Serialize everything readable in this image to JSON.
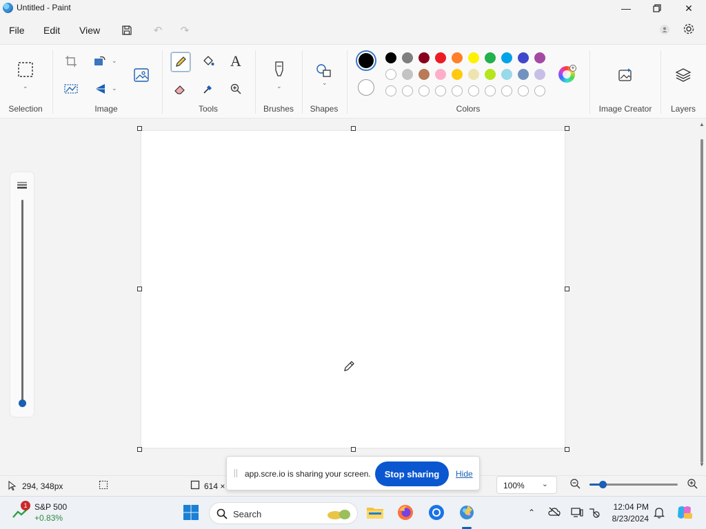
{
  "window": {
    "title": "Untitled - Paint"
  },
  "menu": {
    "file": "File",
    "edit": "Edit",
    "view": "View"
  },
  "ribbon": {
    "groups": {
      "selection": "Selection",
      "image": "Image",
      "tools": "Tools",
      "brushes": "Brushes",
      "shapes": "Shapes",
      "colors": "Colors",
      "image_creator": "Image Creator",
      "layers": "Layers"
    },
    "palette_row1": [
      "#000000",
      "#7f7f7f",
      "#88001b",
      "#ec1c24",
      "#ff7f27",
      "#fff200",
      "#22b14c",
      "#00a2e8",
      "#3f48cc",
      "#a349a4"
    ],
    "palette_row2": [
      "#ffffff",
      "#c3c3c3",
      "#b97a57",
      "#ffaec9",
      "#ffc90e",
      "#efe4b0",
      "#b5e61d",
      "#99d9ea",
      "#7092be",
      "#c8bfe7"
    ],
    "primary_color": "#000000",
    "secondary_color": "#ffffff"
  },
  "status": {
    "cursor_pos": "294, 348px",
    "canvas_size": "614 ×",
    "zoom": "100%",
    "zoom_level": 0.15
  },
  "share": {
    "message": "app.scre.io is sharing your screen.",
    "stop": "Stop sharing",
    "hide": "Hide"
  },
  "taskbar": {
    "stock_name": "S&P 500",
    "stock_change": "+0.83%",
    "stock_badge": "1",
    "search": "Search",
    "time": "12:04 PM",
    "date": "8/23/2024"
  }
}
